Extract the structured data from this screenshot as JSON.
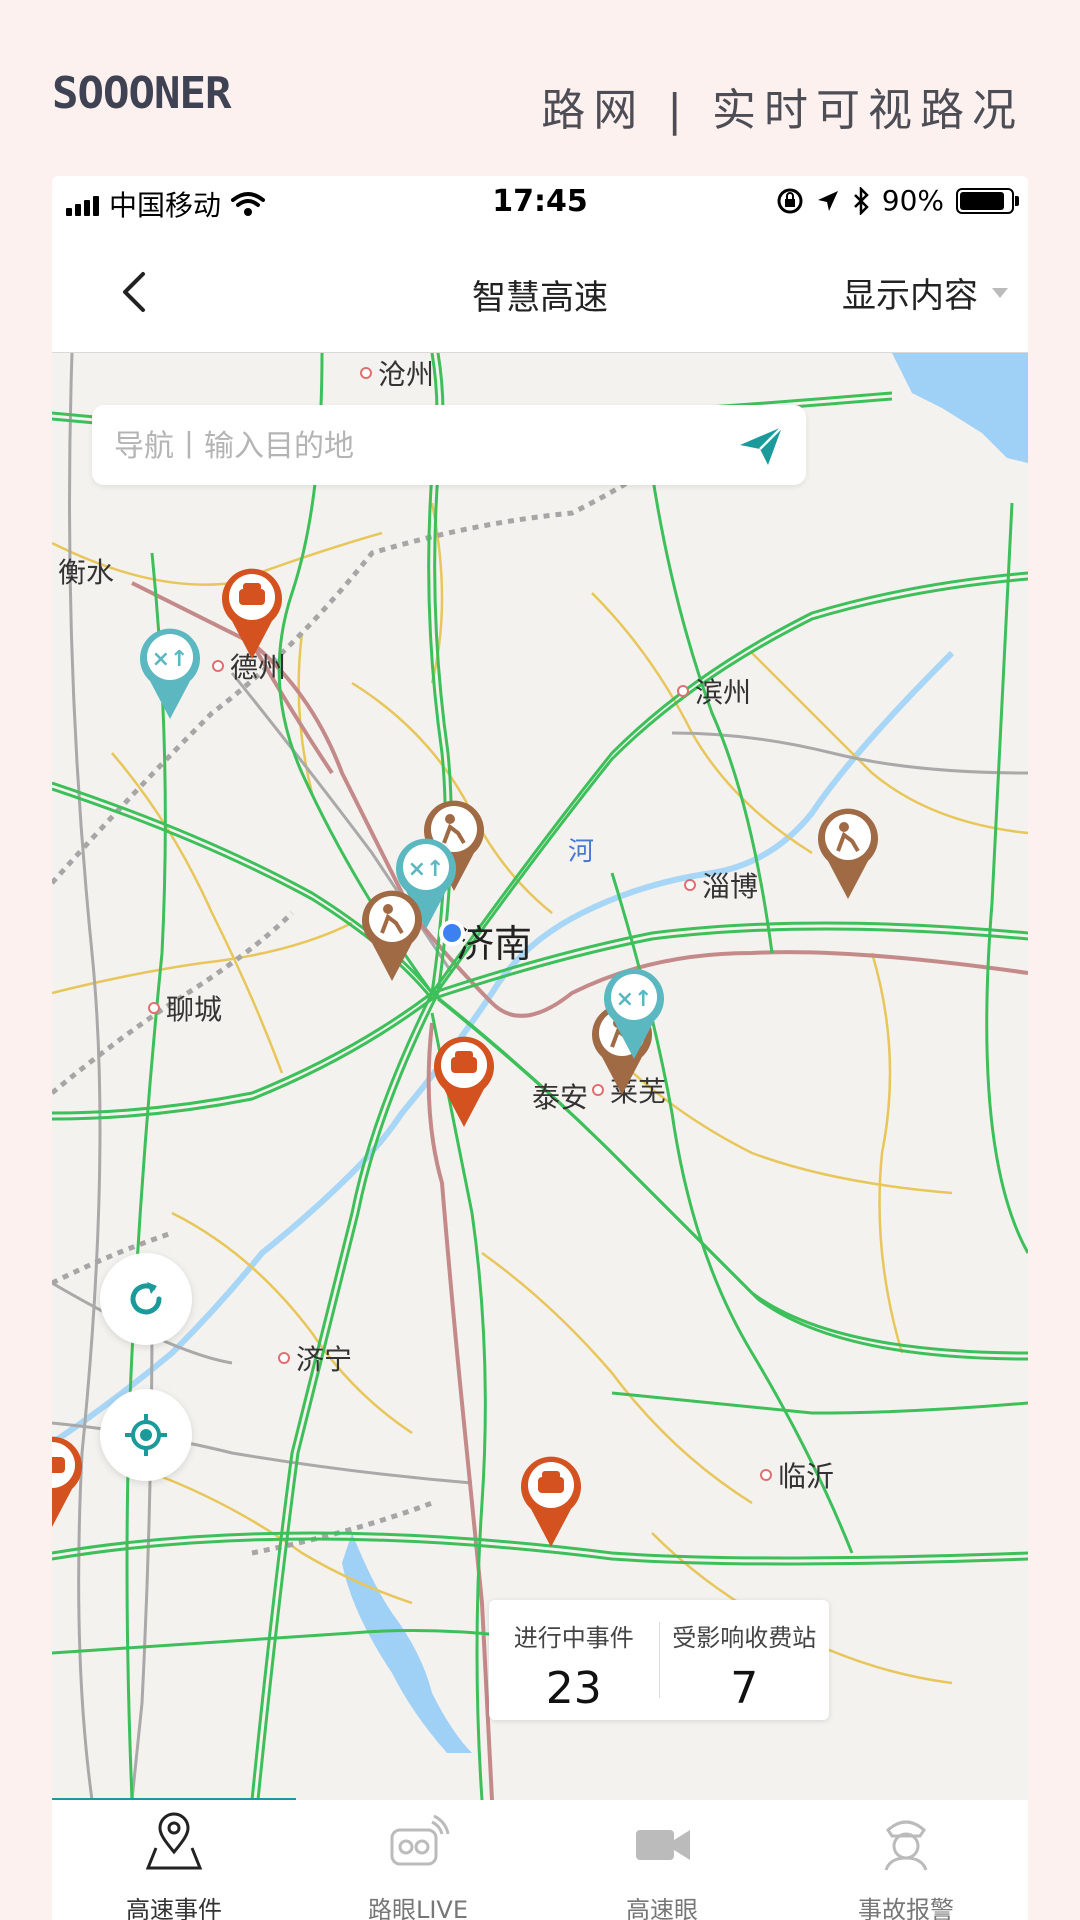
{
  "header": {
    "brand": "SOOONER",
    "tagline": "路网 | 实时可视路况"
  },
  "status_bar": {
    "carrier": "中国移动",
    "time": "17:45",
    "battery": "90%"
  },
  "nav": {
    "title": "智慧高速",
    "right_label": "显示内容"
  },
  "search": {
    "placeholder": "导航丨输入目的地",
    "value": ""
  },
  "map": {
    "cities": {
      "cangzhou": "沧州",
      "hengshui": "衡水",
      "dezhou": "德州",
      "binzhou": "滨州",
      "zibo": "淄博",
      "jinan": "济南",
      "liaocheng": "聊城",
      "taian": "泰安",
      "laiwu": "莱芜",
      "jining": "济宁",
      "linyi": "临沂"
    },
    "river_label": "河"
  },
  "stats": {
    "ongoing_label": "进行中事件",
    "ongoing_value": "23",
    "affected_label": "受影响收费站",
    "affected_value": "7"
  },
  "tabs": [
    {
      "label": "高速事件",
      "icon": "map-pin-icon",
      "active": true
    },
    {
      "label": "路眼LIVE",
      "icon": "live-camera-icon",
      "active": false
    },
    {
      "label": "高速眼",
      "icon": "video-camera-icon",
      "active": false
    },
    {
      "label": "事故报警",
      "icon": "police-icon",
      "active": false
    }
  ],
  "colors": {
    "accent": "#1a9a9a",
    "jam_pin": "#d4521f",
    "construction_pin": "#a06a45",
    "control_pin": "#5bb8c0",
    "highway": "#3dbf5a",
    "water": "#9fd0f5"
  }
}
